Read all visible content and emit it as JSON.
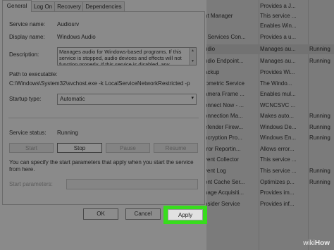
{
  "services": {
    "rows": [
      {
        "name": "",
        "description": "Provides a J...",
        "status": ""
      },
      {
        "name": "nt Manager",
        "description": "This service ...",
        "status": ""
      },
      {
        "name": "",
        "description": "Enables Win...",
        "status": ""
      },
      {
        "name": "t Services Con...",
        "description": "Provides a u...",
        "status": ""
      },
      {
        "name": "udio",
        "description": "Manages au...",
        "status": "Running"
      },
      {
        "name": "udio Endpoint...",
        "description": "Manages au...",
        "status": "Running"
      },
      {
        "name": "ackup",
        "description": "Provides Wi...",
        "status": ""
      },
      {
        "name": "iometric Service",
        "description": "The Windo...",
        "status": ""
      },
      {
        "name": "amera Frame ...",
        "description": "Enables mul...",
        "status": ""
      },
      {
        "name": "onnect Now - ...",
        "description": "WCNCSVC ...",
        "status": ""
      },
      {
        "name": "onnection Ma...",
        "description": "Makes auto...",
        "status": "Running"
      },
      {
        "name": "efender Firew...",
        "description": "Windows De...",
        "status": "Running"
      },
      {
        "name": "ncryption Pro...",
        "description": "Windows En...",
        "status": "Running"
      },
      {
        "name": "rror Reportin...",
        "description": "Allows error...",
        "status": ""
      },
      {
        "name": "vent Collector",
        "description": "This service ...",
        "status": ""
      },
      {
        "name": "vent Log",
        "description": "This service ...",
        "status": "Running"
      },
      {
        "name": "ont Cache Ser...",
        "description": "Optimizes p...",
        "status": "Running"
      },
      {
        "name": "nage Acquisiti...",
        "description": "Provides im...",
        "status": ""
      },
      {
        "name": "nsider Service",
        "description": "Provides inf...",
        "status": ""
      },
      {
        "name": "",
        "description": "",
        "status": ""
      }
    ]
  },
  "dialog": {
    "tabs": [
      "General",
      "Log On",
      "Recovery",
      "Dependencies"
    ],
    "service_name_label": "Service name:",
    "service_name_value": "Audiosrv",
    "display_name_label": "Display name:",
    "display_name_value": "Windows Audio",
    "description_label": "Description:",
    "description_value": "Manages audio for Windows-based programs.  If this service is stopped, audio devices and effects will not function properly.  If this service is disabled, any",
    "path_label": "Path to executable:",
    "path_value": "C:\\Windows\\System32\\svchost.exe -k LocalServiceNetworkRestricted -p",
    "startup_type_label": "Startup type:",
    "startup_type_value": "Automatic",
    "service_status_label": "Service status:",
    "service_status_value": "Running",
    "control_buttons": [
      "Start",
      "Stop",
      "Pause",
      "Resume"
    ],
    "hint_text_line1": "You can specify the start parameters that apply when you start the service",
    "hint_text_line2": "from here.",
    "start_parameters_label": "Start parameters:",
    "start_parameters_value": "",
    "ok_label": "OK",
    "cancel_label": "Cancel",
    "apply_label": "Apply"
  },
  "watermark": {
    "prefix": "wiki",
    "suffix": "How"
  },
  "colors": {
    "highlight": "#37dd1c",
    "dimmed_overlay": "#7c7c7c",
    "apply_button": "#e1e1e1"
  },
  "icons": {
    "scroll_up": "triangle-up",
    "scroll_down": "triangle-down",
    "combo": "chevron-down"
  }
}
